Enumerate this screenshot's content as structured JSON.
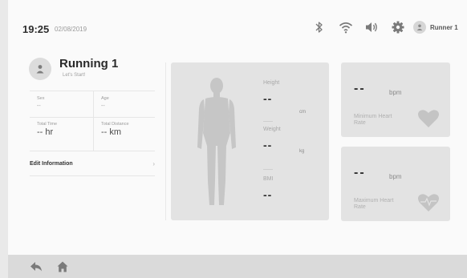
{
  "status_bar": {
    "time": "19:25",
    "date": "02/08/2019",
    "icons": [
      "bluetooth-icon",
      "wifi-icon",
      "volume-icon",
      "settings-icon"
    ],
    "user_name": "Runner 1"
  },
  "profile": {
    "name": "Running 1",
    "subtitle": "Let's Start!",
    "fields": {
      "sex": {
        "label": "Sex",
        "value": "--"
      },
      "age": {
        "label": "Age",
        "value": "--"
      },
      "total_time": {
        "label": "Total Time",
        "value": "-- hr"
      },
      "total_distance": {
        "label": "Total Distance",
        "value": "-- km"
      }
    },
    "edit_label": "Edit Information"
  },
  "body_metrics": {
    "height": {
      "label": "Height",
      "value": "--",
      "unit": "cm"
    },
    "weight": {
      "label": "Weight",
      "value": "--",
      "unit": "kg"
    },
    "bmi": {
      "label": "BMI",
      "value": "--"
    }
  },
  "heart_rate": {
    "minimum": {
      "value": "--",
      "unit": "bpm",
      "label": "Minimum Heart Rate"
    },
    "maximum": {
      "value": "--",
      "unit": "bpm",
      "label": "Maximum Heart Rate"
    }
  },
  "bottom_nav": {
    "icons": [
      "back-icon",
      "home-icon"
    ]
  },
  "colors": {
    "card_bg": "#e3e3e3",
    "screen_bg": "#fafafa",
    "bottom_bar": "#dadada",
    "icon_gray": "#7a7a7a"
  }
}
